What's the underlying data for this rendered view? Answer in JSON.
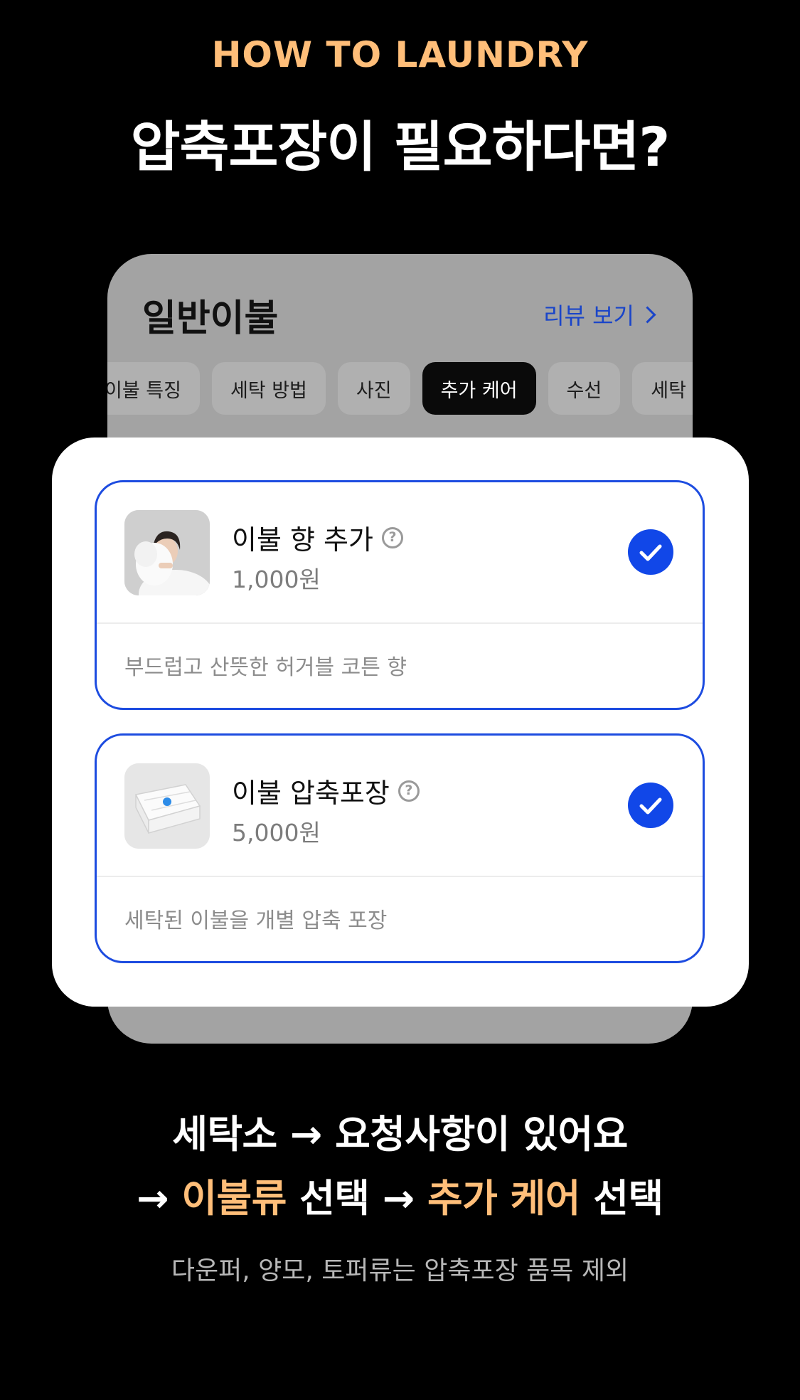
{
  "header": {
    "eyebrow": "HOW TO LAUNDRY",
    "title": "압축포장이 필요하다면?"
  },
  "phone": {
    "title": "일반이불",
    "review_link": "리뷰 보기",
    "tabs": [
      "이불 특징",
      "세탁 방법",
      "사진",
      "추가 케어",
      "수선",
      "세탁 유의"
    ],
    "active_tab": "추가 케어"
  },
  "options": [
    {
      "name": "이불 향 추가",
      "price": "1,000원",
      "description": "부드럽고 산뜻한 허거블 코튼 향",
      "checked": true,
      "image": "woman-hugging-comforter"
    },
    {
      "name": "이불 압축포장",
      "price": "5,000원",
      "description": "세탁된 이불을 개별 압축 포장",
      "checked": true,
      "image": "vacuum-packed-comforter"
    }
  ],
  "steps": {
    "line1": "세탁소 → 요청사항이 있어요",
    "line2_arrow1": "→",
    "line2_hl1": "이불류",
    "line2_text1": "선택",
    "line2_arrow2": "→",
    "line2_hl2": "추가 케어",
    "line2_text2": "선택"
  },
  "note": "다운퍼, 양모, 토퍼류는 압축포장 품목 제외",
  "colors": {
    "background": "#000000",
    "accent_orange": "#FFBE79",
    "accent_blue": "#1147E8",
    "link_blue": "#1A45C9"
  }
}
